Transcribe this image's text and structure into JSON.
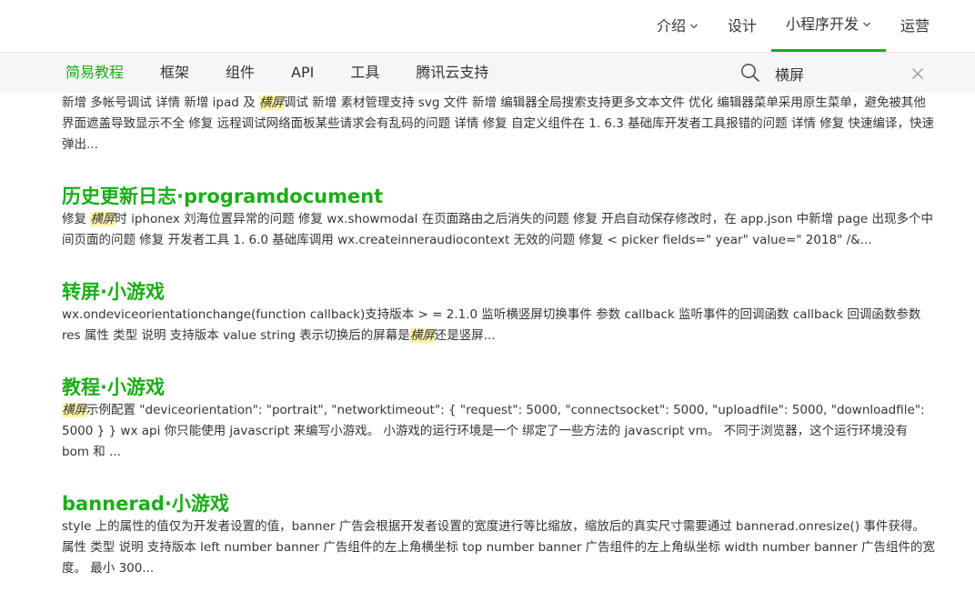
{
  "topnav": {
    "items": [
      {
        "label": "介绍",
        "has_dropdown": true
      },
      {
        "label": "设计",
        "has_dropdown": false
      },
      {
        "label": "小程序开发",
        "has_dropdown": true,
        "active": true
      },
      {
        "label": "运营",
        "has_dropdown": false
      }
    ]
  },
  "subnav": {
    "tabs": [
      "简易教程",
      "框架",
      "组件",
      "API",
      "工具",
      "腾讯云支持"
    ],
    "active_tab": "简易教程"
  },
  "search": {
    "value": "横屏",
    "icon": "search-icon",
    "clear_icon": "close-icon"
  },
  "highlight_term": "横屏",
  "results": [
    {
      "title": "",
      "snippet": "新增 多帐号调试 详情 新增 ipad 及 横屏调试 新增 素材管理支持 svg 文件 新增 编辑器全局搜索支持更多文本文件 优化 编辑器菜单采用原生菜单，避免被其他界面遮盖导致显示不全 修复 远程调试网络面板某些请求会有乱码的问题 详情 修复 自定义组件在 1. 6.3 基础库开发者工具报错的问题 详情 修复 快速编译，快速弹出..."
    },
    {
      "title": "历史更新日志·programdocument",
      "snippet": "修复 横屏时 iphonex 刘海位置异常的问题 修复 wx.showmodal 在页面路由之后消失的问题 修复 开启自动保存修改时，在 app.json 中新增 page 出现多个中间页面的问题 修复 开发者工具 1. 6.0 基础库调用 wx.createinneraudiocontext 无效的问题 修复 < picker fields=\" year\" value=\" 2018\" /&..."
    },
    {
      "title": "转屏·小游戏",
      "snippet": "wx.ondeviceorientationchange(function callback)支持版本 > = 2.1.0 监听横竖屏切换事件 参数 callback 监听事件的回调函数 callback 回调函数参数 res 属性 类型 说明 支持版本 value string 表示切换后的屏幕是横屏还是竖屏..."
    },
    {
      "title": "教程·小游戏",
      "snippet": "横屏示例配置 \"deviceorientation\": \"portrait\", \"networktimeout\": { \"request\": 5000, \"connectsocket\": 5000, \"uploadfile\": 5000, \"downloadfile\": 5000 } } wx api 你只能使用 javascript 来编写小游戏。 小游戏的运行环境是一个 绑定了一些方法的 javascript vm。 不同于浏览器，这个运行环境没有 bom 和 ..."
    },
    {
      "title": "bannerad·小游戏",
      "snippet": "style 上的属性的值仅为开发者设置的值，banner 广告会根据开发者设置的宽度进行等比缩放，缩放后的真实尺寸需要通过 bannerad.onresize() 事件获得。 属性 类型 说明 支持版本 left number banner 广告组件的左上角横坐标 top number banner 广告组件的左上角纵坐标 width number banner 广告组件的宽度。 最小 300..."
    }
  ],
  "colors": {
    "accent": "#1aad19",
    "text": "#353535",
    "highlight_bg": "#fff3a3",
    "subnav_bg": "#f5f6f7"
  }
}
